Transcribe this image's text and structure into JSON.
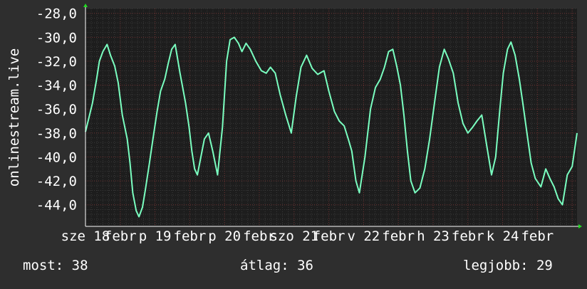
{
  "chart_data": {
    "type": "line",
    "ylabel": "onlinestream.live",
    "ylim": [
      -45.8,
      -27.6
    ],
    "y_ticks": [
      "-28,0",
      "-30,0",
      "-32,0",
      "-34,0",
      "-36,0",
      "-38,0",
      "-40,0",
      "-42,0",
      "-44,0"
    ],
    "y_tick_values": [
      -28,
      -30,
      -32,
      -34,
      -36,
      -38,
      -40,
      -42,
      -44
    ],
    "x_ticks": [
      "sze 18",
      "febr",
      "p 19",
      "febr",
      "p 20",
      "febr",
      "szo 21",
      "febr",
      "v 22",
      "febr",
      "h 23",
      "febr",
      "k 24",
      "febr"
    ],
    "x_tick_days": [
      0,
      0.5,
      1,
      1.5,
      2,
      2.5,
      3,
      3.5,
      4,
      4.5,
      5,
      5.5,
      6,
      6.5
    ],
    "xlim_days": [
      0,
      7.07
    ],
    "grid": true,
    "colors": {
      "background": "#2e2e2e",
      "plot": "#1d1d1d",
      "line": "#7affc0",
      "grid_major": "#6b2f2f",
      "grid_minor": "#3a3a3a",
      "axis_arrow": "#22dd22"
    },
    "series": [
      {
        "x_days": [
          0,
          0.1,
          0.16,
          0.2,
          0.25,
          0.31,
          0.36,
          0.42,
          0.47,
          0.53,
          0.6,
          0.64,
          0.68,
          0.73,
          0.77,
          0.82,
          0.86,
          0.92,
          0.97,
          1.03,
          1.08,
          1.14,
          1.19,
          1.24,
          1.29,
          1.36,
          1.44,
          1.49,
          1.53,
          1.57,
          1.61,
          1.66,
          1.71,
          1.77,
          1.83,
          1.9,
          1.97,
          2.03,
          2.08,
          2.14,
          2.2,
          2.25,
          2.31,
          2.37,
          2.45,
          2.53,
          2.6,
          2.66,
          2.73,
          2.8,
          2.88,
          2.96,
          3.03,
          3.1,
          3.18,
          3.26,
          3.34,
          3.43,
          3.5,
          3.58,
          3.65,
          3.72,
          3.78,
          3.83,
          3.89,
          3.94,
          4.02,
          4.1,
          4.17,
          4.24,
          4.3,
          4.36,
          4.42,
          4.48,
          4.53,
          4.58,
          4.63,
          4.68,
          4.74,
          4.81,
          4.88,
          4.95,
          5.02,
          5.09,
          5.16,
          5.22,
          5.29,
          5.36,
          5.43,
          5.5,
          5.57,
          5.63,
          5.7,
          5.77,
          5.84,
          5.9,
          5.96,
          6.01,
          6.07,
          6.12,
          6.18,
          6.24,
          6.29,
          6.35,
          6.41,
          6.47,
          6.55,
          6.62,
          6.68,
          6.74,
          6.8,
          6.86,
          6.93,
          7.0,
          7.07
        ],
        "values": [
          -37.9,
          -35.5,
          -33.5,
          -32.0,
          -31.2,
          -30.6,
          -31.5,
          -32.4,
          -33.8,
          -36.5,
          -38.5,
          -40.5,
          -43.0,
          -44.5,
          -45.0,
          -44.2,
          -42.8,
          -40.5,
          -38.5,
          -36.2,
          -34.5,
          -33.5,
          -32.2,
          -31.0,
          -30.6,
          -33.0,
          -35.5,
          -37.5,
          -39.5,
          -41.0,
          -41.5,
          -40.0,
          -38.5,
          -38.0,
          -39.5,
          -41.5,
          -37.5,
          -32.0,
          -30.2,
          -30.0,
          -30.5,
          -31.2,
          -30.5,
          -31.0,
          -32.0,
          -32.8,
          -33.0,
          -32.5,
          -33.0,
          -34.8,
          -36.5,
          -38.0,
          -35.0,
          -32.5,
          -31.5,
          -32.6,
          -33.1,
          -32.8,
          -34.5,
          -36.2,
          -37.0,
          -37.4,
          -38.5,
          -39.5,
          -42.0,
          -43.0,
          -40.0,
          -36.0,
          -34.2,
          -33.5,
          -32.5,
          -31.2,
          -31.0,
          -32.5,
          -34.0,
          -36.5,
          -39.5,
          -42.0,
          -43.0,
          -42.6,
          -41.0,
          -38.5,
          -35.5,
          -32.5,
          -31.0,
          -31.8,
          -33.0,
          -35.5,
          -37.2,
          -38.0,
          -37.5,
          -37.0,
          -36.5,
          -39.0,
          -41.5,
          -40.0,
          -36.0,
          -33.0,
          -31.0,
          -30.4,
          -31.5,
          -33.5,
          -35.5,
          -38.0,
          -40.5,
          -41.8,
          -42.5,
          -41.0,
          -41.8,
          -42.5,
          -43.5,
          -44.0,
          -41.5,
          -40.8,
          -38.0
        ]
      }
    ]
  },
  "stats": {
    "now": "most: 38",
    "avg": "átlag: 36",
    "best": "legjobb: 29"
  }
}
